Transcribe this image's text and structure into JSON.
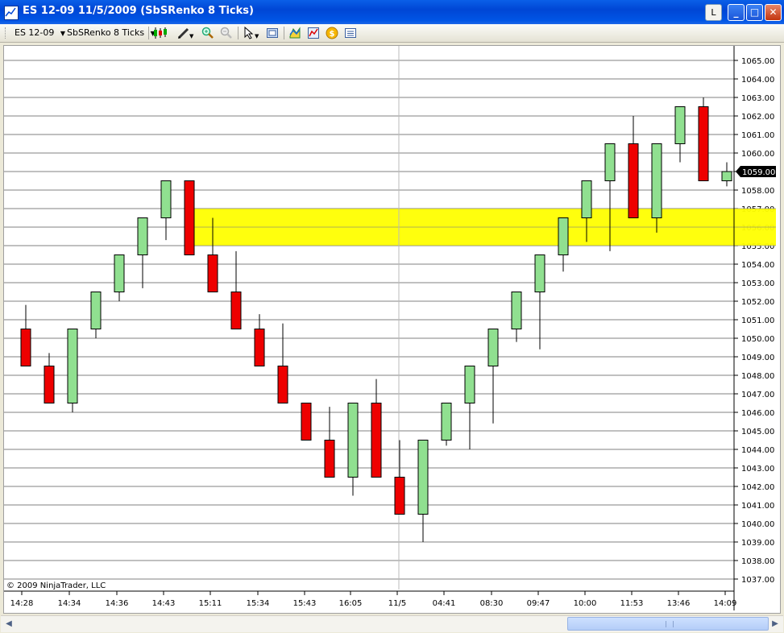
{
  "window": {
    "title": "ES 12-09  11/5/2009 (SbSRenko 8 Ticks)",
    "btn_l": "L",
    "btn_min": "_",
    "btn_max": "□",
    "btn_close": "✕"
  },
  "toolbar": {
    "instrument": "ES 12-09",
    "period": "SbSRenko 8 Ticks",
    "icons": [
      "candlestick-icon",
      "drawing-pencil-icon",
      "zoom-in-icon",
      "zoom-out-icon",
      "cursor-pointer-icon",
      "properties-icon",
      "data-box-icon",
      "indicators-icon",
      "strategies-icon",
      "chart-trader-icon"
    ]
  },
  "chart": {
    "copyright": "© 2009 NinjaTrader, LLC",
    "price_labels": [
      "1065.00",
      "1064.00",
      "1063.00",
      "1062.00",
      "1061.00",
      "1060.00",
      "1059.00",
      "1058.00",
      "1057.00",
      "1056.00",
      "1055.00",
      "1054.00",
      "1053.00",
      "1052.00",
      "1051.00",
      "1050.00",
      "1049.00",
      "1048.00",
      "1047.00",
      "1046.00",
      "1045.00",
      "1044.00",
      "1043.00",
      "1042.00",
      "1041.00",
      "1040.00",
      "1039.00",
      "1038.00",
      "1037.00"
    ],
    "current_price_label": "1059.00",
    "time_labels": [
      "14:28",
      "14:34",
      "14:36",
      "14:43",
      "15:11",
      "15:34",
      "15:43",
      "16:05",
      "11/5",
      "04:41",
      "08:30",
      "09:47",
      "10:00",
      "11:53",
      "13:46",
      "14:09"
    ],
    "colors": {
      "up": "#90e090",
      "down": "#ee0000",
      "zone": "#ffff00"
    }
  },
  "chart_data": {
    "type": "candlestick",
    "instrument": "ES 12-09",
    "period": "SbSRenko 8 Ticks",
    "ylim": [
      1036.5,
      1065.5
    ],
    "current_price": 1059.0,
    "zone": [
      1055.0,
      1057.0
    ],
    "candles": [
      {
        "o": 1050.5,
        "h": 1051.8,
        "l": 1048.5,
        "c": 1048.5
      },
      {
        "o": 1048.5,
        "h": 1049.2,
        "l": 1046.5,
        "c": 1046.5
      },
      {
        "o": 1046.5,
        "h": 1050.5,
        "l": 1046.0,
        "c": 1050.5
      },
      {
        "o": 1050.5,
        "h": 1052.5,
        "l": 1050.0,
        "c": 1052.5
      },
      {
        "o": 1052.5,
        "h": 1054.5,
        "l": 1052.0,
        "c": 1054.5
      },
      {
        "o": 1054.5,
        "h": 1056.5,
        "l": 1052.7,
        "c": 1056.5
      },
      {
        "o": 1056.5,
        "h": 1058.5,
        "l": 1055.3,
        "c": 1058.5
      },
      {
        "o": 1058.5,
        "h": 1058.5,
        "l": 1054.5,
        "c": 1054.5
      },
      {
        "o": 1054.5,
        "h": 1056.5,
        "l": 1052.5,
        "c": 1052.5
      },
      {
        "o": 1052.5,
        "h": 1054.7,
        "l": 1050.5,
        "c": 1050.5
      },
      {
        "o": 1050.5,
        "h": 1051.3,
        "l": 1048.5,
        "c": 1048.5
      },
      {
        "o": 1048.5,
        "h": 1050.8,
        "l": 1046.5,
        "c": 1046.5
      },
      {
        "o": 1046.5,
        "h": 1046.5,
        "l": 1044.5,
        "c": 1044.5
      },
      {
        "o": 1044.5,
        "h": 1046.3,
        "l": 1042.5,
        "c": 1042.5
      },
      {
        "o": 1042.5,
        "h": 1046.5,
        "l": 1041.5,
        "c": 1046.5
      },
      {
        "o": 1046.5,
        "h": 1047.8,
        "l": 1042.5,
        "c": 1042.5
      },
      {
        "o": 1042.5,
        "h": 1044.5,
        "l": 1040.5,
        "c": 1040.5
      },
      {
        "o": 1040.5,
        "h": 1044.5,
        "l": 1039.0,
        "c": 1044.5
      },
      {
        "o": 1044.5,
        "h": 1046.5,
        "l": 1044.2,
        "c": 1046.5
      },
      {
        "o": 1046.5,
        "h": 1048.5,
        "l": 1044.0,
        "c": 1048.5
      },
      {
        "o": 1048.5,
        "h": 1050.5,
        "l": 1045.4,
        "c": 1050.5
      },
      {
        "o": 1050.5,
        "h": 1052.5,
        "l": 1049.8,
        "c": 1052.5
      },
      {
        "o": 1052.5,
        "h": 1054.5,
        "l": 1049.4,
        "c": 1054.5
      },
      {
        "o": 1054.5,
        "h": 1056.5,
        "l": 1053.6,
        "c": 1056.5
      },
      {
        "o": 1056.5,
        "h": 1058.5,
        "l": 1055.2,
        "c": 1058.5
      },
      {
        "o": 1058.5,
        "h": 1060.5,
        "l": 1054.7,
        "c": 1060.5
      },
      {
        "o": 1060.5,
        "h": 1062.0,
        "l": 1056.5,
        "c": 1056.5
      },
      {
        "o": 1056.5,
        "h": 1060.5,
        "l": 1055.7,
        "c": 1060.5
      },
      {
        "o": 1060.5,
        "h": 1062.5,
        "l": 1059.5,
        "c": 1062.5
      },
      {
        "o": 1062.5,
        "h": 1063.0,
        "l": 1058.5,
        "c": 1058.5
      },
      {
        "o": 1058.5,
        "h": 1059.5,
        "l": 1058.2,
        "c": 1059.0
      }
    ]
  }
}
